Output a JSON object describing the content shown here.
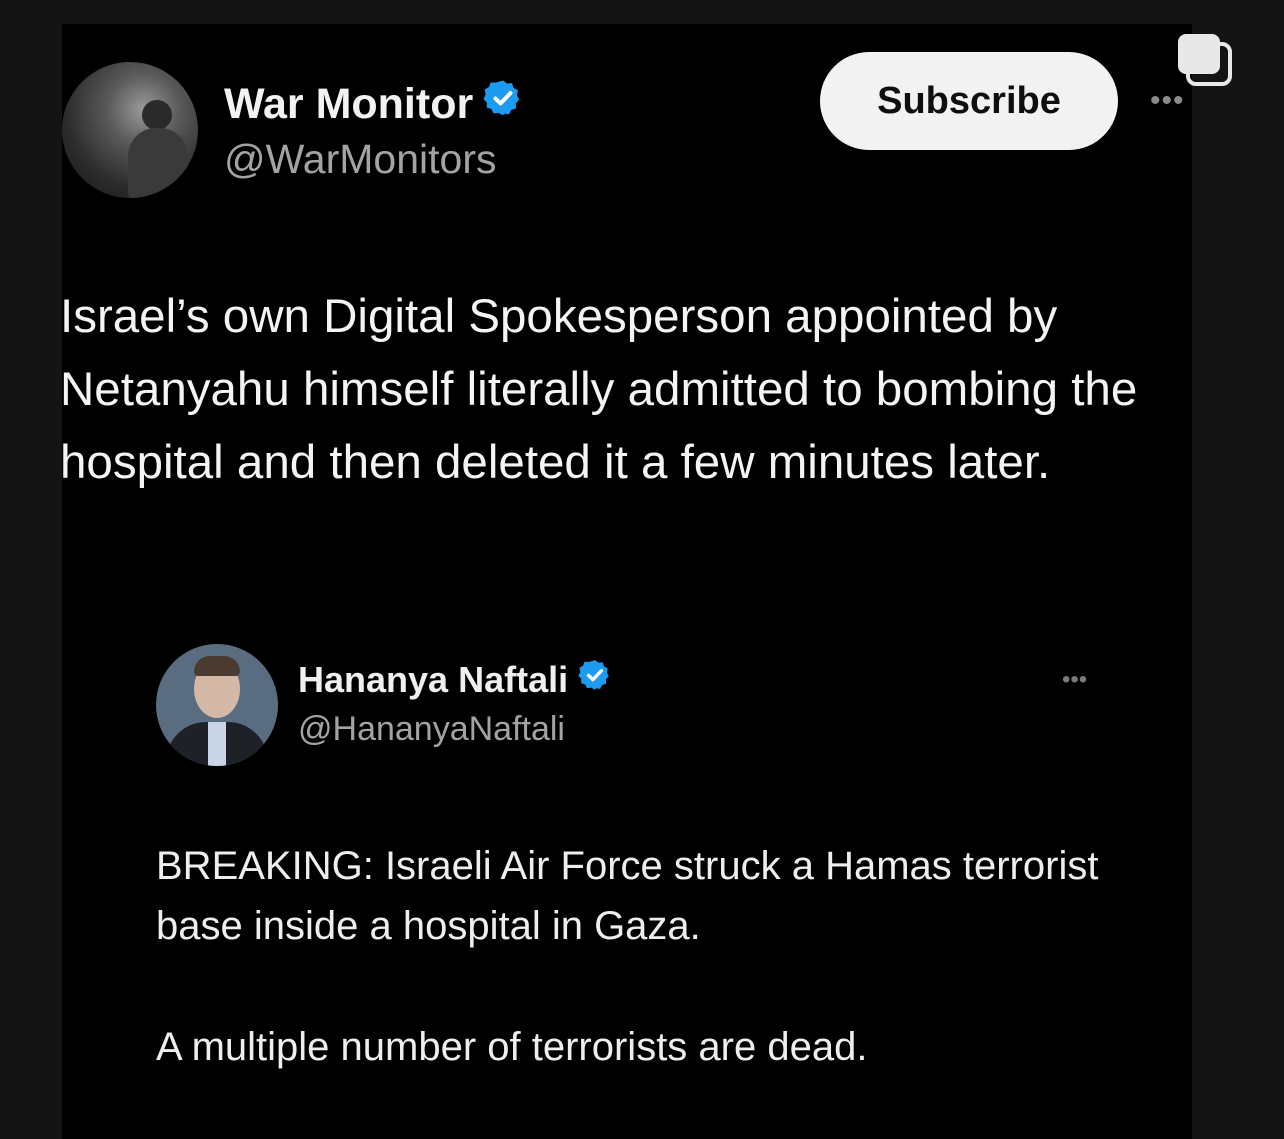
{
  "post": {
    "author_name": "War Monitor",
    "author_handle": "@WarMonitors",
    "subscribe_label": "Subscribe",
    "more_label": "•••",
    "text": "Israel’s own Digital Spokesperson appointed by Netanyahu himself literally admitted to bombing the hospital and then deleted it a few minutes later."
  },
  "quoted_post": {
    "author_name": "Hananya Naftali",
    "author_handle": "@HananyaNaftali",
    "more_label": "•••",
    "text_paragraph_1": "BREAKING: Israeli Air Force struck a Hamas terrorist base inside a hospital in Gaza.",
    "text_paragraph_2": "A multiple number of terrorists are dead."
  },
  "colors": {
    "background": "#000000",
    "verified_badge": "#1d9bf0",
    "subscribe_bg": "#f2f2f2"
  },
  "icons": {
    "verified": "verified-badge-icon",
    "copy": "copy-icon",
    "more": "more-dots-icon"
  }
}
